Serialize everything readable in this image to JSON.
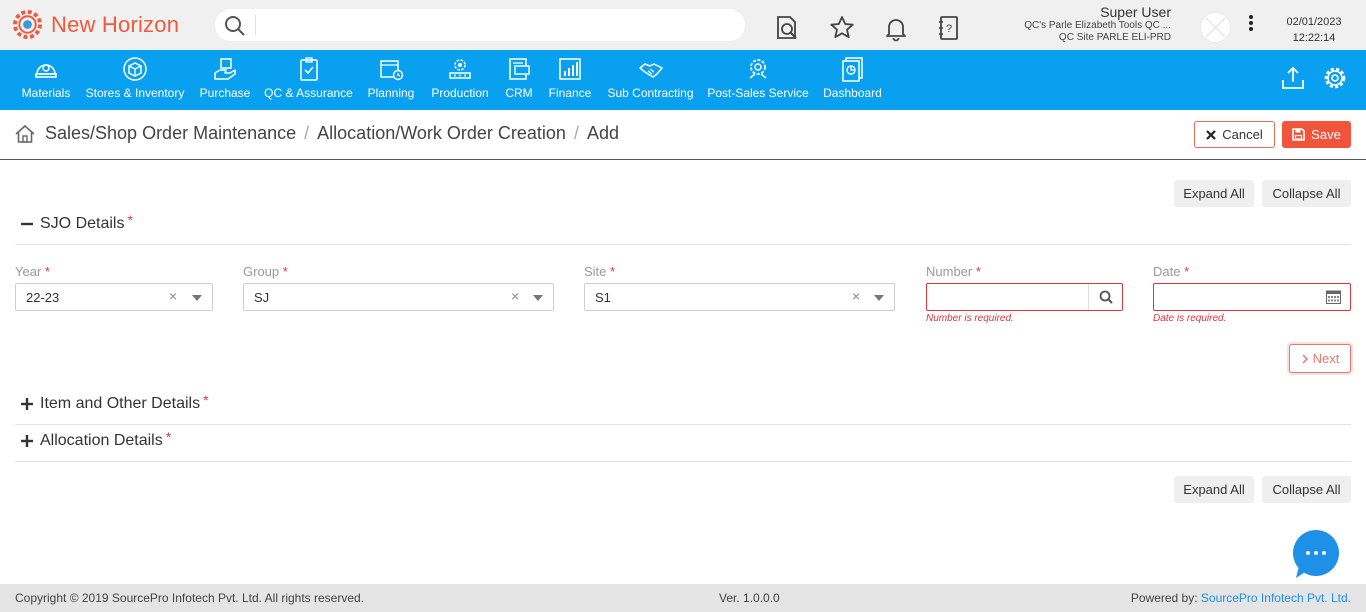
{
  "app": {
    "name": "New Horizon",
    "brand_color": "#ee5a3f",
    "nav_color": "#0aa0f0"
  },
  "header": {
    "search_placeholder": "",
    "user_name": "Super User",
    "company": "QC's Parle Elizabeth Tools QC ...",
    "site": "QC Site PARLE ELI-PRD",
    "date": "02/01/2023",
    "time": "12:22:14",
    "icons": [
      "document-search-icon",
      "star-icon",
      "bell-icon",
      "notebook-help-icon"
    ]
  },
  "nav": {
    "items": [
      {
        "label": "Materials",
        "icon": "helmet-icon"
      },
      {
        "label": "Stores & Inventory",
        "icon": "box-icon"
      },
      {
        "label": "Purchase",
        "icon": "hand-box-icon"
      },
      {
        "label": "QC & Assurance",
        "icon": "clipboard-check-icon"
      },
      {
        "label": "Planning",
        "icon": "calendar-clock-icon"
      },
      {
        "label": "Production",
        "icon": "factory-gear-icon"
      },
      {
        "label": "CRM",
        "icon": "crm-card-icon"
      },
      {
        "label": "Finance",
        "icon": "bar-chart-icon"
      },
      {
        "label": "Sub Contracting",
        "icon": "handshake-icon"
      },
      {
        "label": "Post-Sales Service",
        "icon": "service-gear-icon"
      },
      {
        "label": "Dashboard",
        "icon": "dashboard-icon"
      }
    ]
  },
  "breadcrumb": {
    "items": [
      "Sales/Shop Order Maintenance",
      "Allocation/Work Order Creation",
      "Add"
    ],
    "separator": "/"
  },
  "actions": {
    "cancel": "Cancel",
    "save": "Save",
    "expand_all": "Expand All",
    "collapse_all": "Collapse All",
    "next": "Next"
  },
  "sections": {
    "sjo": {
      "title": "SJO Details",
      "state": "expanded"
    },
    "item": {
      "title": "Item and Other Details",
      "state": "collapsed"
    },
    "allocation": {
      "title": "Allocation Details",
      "state": "collapsed"
    }
  },
  "form": {
    "year": {
      "label": "Year",
      "value": "22-23"
    },
    "group": {
      "label": "Group",
      "value": "SJ"
    },
    "site": {
      "label": "Site",
      "value": "S1"
    },
    "number": {
      "label": "Number",
      "value": "",
      "error": "Number is required."
    },
    "date": {
      "label": "Date",
      "value": "",
      "error": "Date is required."
    },
    "required_mark": "*"
  },
  "footer": {
    "copyright": "Copyright © 2019 SourcePro Infotech Pvt. Ltd. All rights reserved.",
    "version": "Ver. 1.0.0.0",
    "powered_by": "Powered by:",
    "powered_link": "SourcePro Infotech Pvt. Ltd."
  }
}
